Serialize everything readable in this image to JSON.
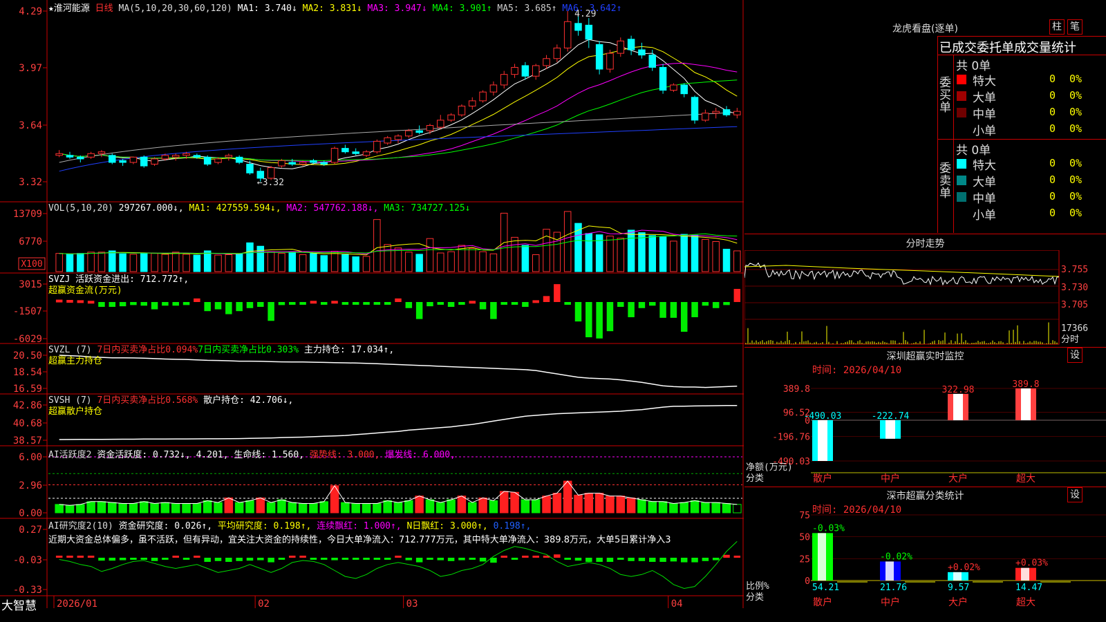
{
  "kline": {
    "stock_name": "★淮河能源",
    "period": "日线",
    "ma_header": "MA(5,10,20,30,60,120)",
    "ma_values": [
      {
        "label": "MA1: 3.740↓",
        "color": "#ffffff"
      },
      {
        "label": "MA2: 3.831↓",
        "color": "#ffff00"
      },
      {
        "label": "MA3: 3.947↓",
        "color": "#ff00ff"
      },
      {
        "label": "MA4: 3.901↑",
        "color": "#00ff00"
      },
      {
        "label": "MA5: 3.685↑",
        "color": "#cccccc"
      },
      {
        "label": "MA6: 3.642↑",
        "color": "#2040ff"
      }
    ],
    "y_ticks": [
      "4.29",
      "3.97",
      "3.64",
      "3.32"
    ],
    "high_label": "4.29",
    "low_label": "←3.32",
    "candles": [
      [
        3.47,
        3.5,
        3.46,
        3.48
      ],
      [
        3.47,
        3.49,
        3.45,
        3.46
      ],
      [
        3.46,
        3.47,
        3.43,
        3.45
      ],
      [
        3.46,
        3.49,
        3.45,
        3.48
      ],
      [
        3.48,
        3.5,
        3.46,
        3.49
      ],
      [
        3.47,
        3.48,
        3.42,
        3.43
      ],
      [
        3.44,
        3.45,
        3.41,
        3.43
      ],
      [
        3.43,
        3.46,
        3.42,
        3.46
      ],
      [
        3.46,
        3.47,
        3.4,
        3.41
      ],
      [
        3.42,
        3.46,
        3.41,
        3.45
      ],
      [
        3.45,
        3.48,
        3.44,
        3.47
      ],
      [
        3.46,
        3.48,
        3.44,
        3.47
      ],
      [
        3.47,
        3.49,
        3.45,
        3.48
      ],
      [
        3.47,
        3.48,
        3.45,
        3.46
      ],
      [
        3.46,
        3.47,
        3.41,
        3.42
      ],
      [
        3.43,
        3.46,
        3.42,
        3.45
      ],
      [
        3.46,
        3.48,
        3.44,
        3.47
      ],
      [
        3.46,
        3.47,
        3.42,
        3.43
      ],
      [
        3.42,
        3.44,
        3.36,
        3.37
      ],
      [
        3.38,
        3.4,
        3.32,
        3.34
      ],
      [
        3.34,
        3.41,
        3.33,
        3.4
      ],
      [
        3.41,
        3.45,
        3.4,
        3.44
      ],
      [
        3.43,
        3.45,
        3.41,
        3.42
      ],
      [
        3.42,
        3.44,
        3.41,
        3.43
      ],
      [
        3.44,
        3.45,
        3.42,
        3.43
      ],
      [
        3.43,
        3.44,
        3.41,
        3.42
      ],
      [
        3.43,
        3.52,
        3.42,
        3.51
      ],
      [
        3.51,
        3.53,
        3.48,
        3.49
      ],
      [
        3.49,
        3.51,
        3.47,
        3.48
      ],
      [
        3.47,
        3.5,
        3.46,
        3.49
      ],
      [
        3.49,
        3.56,
        3.48,
        3.55
      ],
      [
        3.54,
        3.58,
        3.53,
        3.57
      ],
      [
        3.56,
        3.59,
        3.54,
        3.58
      ],
      [
        3.58,
        3.62,
        3.57,
        3.61
      ],
      [
        3.61,
        3.64,
        3.59,
        3.6
      ],
      [
        3.61,
        3.65,
        3.59,
        3.64
      ],
      [
        3.63,
        3.7,
        3.62,
        3.67
      ],
      [
        3.67,
        3.71,
        3.66,
        3.7
      ],
      [
        3.7,
        3.76,
        3.69,
        3.75
      ],
      [
        3.75,
        3.8,
        3.73,
        3.78
      ],
      [
        3.78,
        3.84,
        3.77,
        3.83
      ],
      [
        3.83,
        3.89,
        3.81,
        3.87
      ],
      [
        3.87,
        3.95,
        3.85,
        3.93
      ],
      [
        3.93,
        3.99,
        3.91,
        3.97
      ],
      [
        3.98,
        4.0,
        3.9,
        3.92
      ],
      [
        3.92,
        3.99,
        3.9,
        3.98
      ],
      [
        3.98,
        4.04,
        3.96,
        4.02
      ],
      [
        4.02,
        4.1,
        4.0,
        4.08
      ],
      [
        4.08,
        4.29,
        4.06,
        4.23
      ],
      [
        4.22,
        4.28,
        4.15,
        4.18
      ],
      [
        4.21,
        4.25,
        4.08,
        4.13
      ],
      [
        4.1,
        4.12,
        3.93,
        3.96
      ],
      [
        3.96,
        4.07,
        3.94,
        4.05
      ],
      [
        4.05,
        4.14,
        4.03,
        4.12
      ],
      [
        4.13,
        4.15,
        4.04,
        4.07
      ],
      [
        4.07,
        4.11,
        4.02,
        4.04
      ],
      [
        4.04,
        4.07,
        3.95,
        3.97
      ],
      [
        3.97,
        3.99,
        3.82,
        3.84
      ],
      [
        3.84,
        3.88,
        3.83,
        3.87
      ],
      [
        3.87,
        3.88,
        3.8,
        3.82
      ],
      [
        3.8,
        3.81,
        3.65,
        3.67
      ],
      [
        3.67,
        3.73,
        3.66,
        3.71
      ],
      [
        3.71,
        3.74,
        3.68,
        3.72
      ],
      [
        3.73,
        3.75,
        3.69,
        3.7
      ],
      [
        3.7,
        3.74,
        3.68,
        3.72
      ]
    ],
    "x_labels": [
      {
        "label": "2026/01",
        "idx": 0
      },
      {
        "label": "02",
        "idx": 19
      },
      {
        "label": "03",
        "idx": 33
      },
      {
        "label": "04",
        "idx": 58
      }
    ]
  },
  "vol": {
    "title": "VOL(5,10,20)",
    "value": "297267.000↓,",
    "ma_values": [
      {
        "label": "MA1: 427559.594↓,",
        "color": "#ffff00"
      },
      {
        "label": "MA2: 547762.188↓,",
        "color": "#ff00ff"
      },
      {
        "label": "MA3: 734727.125↓",
        "color": "#00ff00"
      }
    ],
    "y_ticks": [
      "13709",
      "6770"
    ],
    "unit": "X100",
    "values": [
      430,
      410,
      430,
      460,
      460,
      490,
      420,
      410,
      440,
      430,
      410,
      460,
      410,
      390,
      490,
      390,
      400,
      420,
      680,
      600,
      470,
      430,
      460,
      400,
      430,
      380,
      480,
      400,
      350,
      360,
      1230,
      640,
      560,
      460,
      410,
      780,
      440,
      470,
      620,
      550,
      470,
      420,
      1380,
      810,
      620,
      400,
      1000,
      930,
      1420,
      1140,
      900,
      870,
      840,
      790,
      980,
      920,
      850,
      820,
      720,
      880,
      860,
      760,
      710,
      530,
      490,
      310
    ],
    "ymax": 13709
  },
  "svzj": {
    "title": "SVZJ  活跃资金进出: 712.772↑,",
    "subtitle": "超赢资金流(万元)",
    "y_ticks": [
      "3015",
      "-1507",
      "-6029"
    ],
    "values": [
      400,
      350,
      300,
      200,
      -800,
      -800,
      -700,
      -500,
      -600,
      -1200,
      -600,
      -600,
      -500,
      600,
      -1500,
      -1200,
      -2000,
      -1500,
      -1000,
      -800,
      -3100,
      -500,
      -200,
      -300,
      200,
      -300,
      200,
      -300,
      -200,
      -200,
      -300,
      -200,
      600,
      -1000,
      -2800,
      -700,
      -300,
      -800,
      -300,
      200,
      -1200,
      -2800,
      -400,
      -300,
      -800,
      300,
      1000,
      3000,
      -300,
      -3200,
      -5800,
      -6000,
      -4800,
      -800,
      -2500,
      -1000,
      -600,
      -2600,
      -2600,
      -4900,
      -2500,
      -600,
      -1000,
      -500,
      2200,
      1300,
      300,
      500
    ],
    "ymin": -6029,
    "ymax": 3015
  },
  "svzl": {
    "title": "SVZL (7)",
    "red_text": "7日内买卖净占比0.094%",
    "green_text": "7日内买卖净占比0.303%",
    "value": "主力持仓: 17.034↑,",
    "subtitle": "超赢主力持仓",
    "y_ticks": [
      "20.50",
      "18.54",
      "16.59"
    ],
    "values": [
      20.5,
      20.45,
      20.4,
      20.3,
      20.25,
      20.2,
      20.2,
      20.18,
      20.15,
      20.1,
      20.05,
      20.02,
      20.0,
      19.95,
      19.9,
      19.88,
      19.85,
      19.8,
      19.8,
      19.78,
      19.75,
      19.72,
      19.7,
      19.7,
      19.68,
      19.65,
      19.62,
      19.6,
      19.58,
      19.55,
      19.5,
      19.45,
      19.4,
      19.35,
      19.3,
      19.25,
      19.2,
      19.15,
      19.1,
      19.05,
      19.0,
      18.95,
      18.9,
      18.85,
      18.8,
      18.7,
      18.5,
      18.3,
      18.1,
      17.9,
      17.8,
      17.75,
      17.7,
      17.6,
      17.45,
      17.3,
      17.1,
      16.9,
      16.8,
      16.75,
      16.75,
      16.7,
      16.75,
      16.8,
      16.85,
      16.9,
      16.95,
      17.0
    ],
    "ymin": 16.59,
    "ymax": 20.5
  },
  "svsh": {
    "title": "SVSH (7)",
    "red_text": "7日内买卖净占比0.568%",
    "value": "散户持仓: 42.706↓,",
    "subtitle": "超赢散户持仓",
    "y_ticks": [
      "42.86",
      "40.68",
      "38.57"
    ],
    "values": [
      38.65,
      38.66,
      38.67,
      38.68,
      38.68,
      38.69,
      38.7,
      38.7,
      38.71,
      38.72,
      38.72,
      38.73,
      38.73,
      38.74,
      38.75,
      38.75,
      38.76,
      38.77,
      38.8,
      38.82,
      38.85,
      38.9,
      38.92,
      38.95,
      39.0,
      39.05,
      39.1,
      39.15,
      39.25,
      39.35,
      39.45,
      39.55,
      39.65,
      39.8,
      39.9,
      40.0,
      40.1,
      40.2,
      40.35,
      40.5,
      40.7,
      40.9,
      41.1,
      41.3,
      41.5,
      41.6,
      41.7,
      41.8,
      41.85,
      41.9,
      41.95,
      42.0,
      42.05,
      42.1,
      42.2,
      42.3,
      42.45,
      42.6,
      42.7,
      42.72,
      42.74,
      42.76,
      42.78,
      42.8,
      42.8,
      42.78,
      42.75,
      42.72
    ],
    "ymin": 38.57,
    "ymax": 42.86
  },
  "ai_active": {
    "title": "AI活跃度2",
    "value": "资金活跃度: 0.732↓,",
    "value2": "4.201,",
    "life_label": "生命线: 1.560,",
    "strong_label": "强势线: 3.000,",
    "burst_label": "爆发线: 6.000,",
    "y_ticks": [
      "6.00",
      "2.96",
      "0.00"
    ],
    "values": [
      0.9,
      0.8,
      0.9,
      1.2,
      1.2,
      1.1,
      1.0,
      1.0,
      1.2,
      1.0,
      1.1,
      1.0,
      1.0,
      1.0,
      1.3,
      1.1,
      1.6,
      1.1,
      1.3,
      1.6,
      1.1,
      1.4,
      1.1,
      1.0,
      1.0,
      1.2,
      2.9,
      1.1,
      1.0,
      1.0,
      1.0,
      1.3,
      1.1,
      1.3,
      1.8,
      1.4,
      1.1,
      1.4,
      1.8,
      1.1,
      1.6,
      1.3,
      2.3,
      2.2,
      1.4,
      1.4,
      1.8,
      2.1,
      3.4,
      1.9,
      2.1,
      2.1,
      1.8,
      1.8,
      1.6,
      1.4,
      1.2,
      1.2,
      1.0,
      1.1,
      1.3,
      1.1,
      1.1,
      1.0,
      0.9,
      0.8
    ],
    "ymax": 6.0
  },
  "ai_research": {
    "title": "AI研究度2(10)",
    "value": "资金研究度: 0.026↑,",
    "avg": "平均研究度: 0.198↑,",
    "red_count": "连续飘红: 1.000↑,",
    "n_red": "N日飘红: 3.000↑,",
    "last": "0.198↑,",
    "comment": "近期大资金总体偏多，虽不活跃，但有异动，宜关注大资金的持续性，今日大单净流入：712.777万元，其中特大单净流入：389.8万元，大单5日累计净入3",
    "y_ticks": [
      "0.27",
      "-0.03",
      "-0.33"
    ],
    "bars": [
      0.05,
      0.05,
      0.04,
      0.04,
      -0.07,
      -0.07,
      -0.06,
      -0.05,
      -0.05,
      -0.08,
      -0.05,
      0.04,
      -0.05,
      0.05,
      -0.1,
      -0.08,
      -0.1,
      -0.08,
      -0.07,
      -0.06,
      -0.11,
      -0.05,
      0.03,
      0.03,
      -0.04,
      -0.05,
      -0.06,
      -0.05,
      -0.04,
      -0.05,
      -0.04,
      -0.04,
      0.05,
      -0.06,
      -0.11,
      -0.05,
      -0.06,
      -0.08,
      -0.06,
      -0.04,
      -0.09,
      -0.12,
      0.04,
      -0.03,
      0.04,
      0.04,
      0.05,
      0.08,
      -0.02,
      -0.07,
      -0.1,
      -0.1,
      -0.1,
      -0.04,
      -0.08,
      -0.08,
      -0.1,
      -0.1,
      -0.09,
      -0.11,
      -0.11,
      -0.08,
      -0.06,
      0.07,
      0.05,
      0.03
    ],
    "line": [
      -0.03,
      -0.05,
      -0.08,
      -0.1,
      -0.15,
      -0.12,
      -0.08,
      -0.05,
      -0.04,
      -0.07,
      -0.1,
      -0.12,
      -0.1,
      -0.08,
      -0.12,
      -0.16,
      -0.14,
      -0.12,
      -0.08,
      -0.12,
      -0.16,
      -0.12,
      -0.06,
      -0.04,
      -0.05,
      -0.08,
      -0.14,
      -0.2,
      -0.22,
      -0.18,
      -0.12,
      -0.08,
      -0.06,
      -0.08,
      -0.1,
      -0.14,
      -0.2,
      -0.18,
      -0.14,
      -0.12,
      -0.08,
      0.0,
      0.06,
      0.1,
      0.08,
      0.05,
      0.02,
      -0.05,
      -0.1,
      -0.08,
      -0.06,
      -0.08,
      -0.12,
      -0.18,
      -0.2,
      -0.18,
      -0.14,
      -0.2,
      -0.28,
      -0.32,
      -0.3,
      -0.2,
      -0.08,
      0.05,
      0.15,
      0.24
    ],
    "ymin": -0.33,
    "ymax": 0.27
  },
  "brand": "大智慧",
  "right": {
    "longhu_title": "龙虎看盘(逐单)",
    "btn_bar": "柱",
    "btn_pen": "笔",
    "table_header": "已成交委托单成交量统计",
    "buy_label": "委买单",
    "sell_label": "委卖单",
    "buy_total": "共 0单",
    "sell_total": "共 0单",
    "buy_rows": [
      {
        "label": "特大",
        "count": "0",
        "pct": "0%",
        "color": "#ff0000"
      },
      {
        "label": "大单",
        "count": "0",
        "pct": "0%",
        "color": "#a00000"
      },
      {
        "label": "中单",
        "count": "0",
        "pct": "0%",
        "color": "#700000"
      },
      {
        "label": "小单",
        "count": "0",
        "pct": "0%",
        "color": "#000000"
      }
    ],
    "sell_rows": [
      {
        "label": "特大",
        "count": "0",
        "pct": "0%",
        "color": "#00ffff"
      },
      {
        "label": "大单",
        "count": "0",
        "pct": "0%",
        "color": "#008888"
      },
      {
        "label": "中单",
        "count": "0",
        "pct": "0%",
        "color": "#007070"
      },
      {
        "label": "小单",
        "count": "0",
        "pct": "0%",
        "color": "#000000"
      }
    ],
    "minute_title": "分时走势",
    "minute_prices": [
      "3.755",
      "3.730",
      "3.705"
    ],
    "minute_vol": "17366",
    "minute_unit": "分时",
    "realtime_title": "深圳超赢实时监控",
    "realtime_time": "时间: 2026/04/10",
    "realtime_settings": "设",
    "realtime_y": [
      "389.8",
      "96.52",
      "0",
      "-196.76",
      "-490.03"
    ],
    "realtime_axis_label": "净额(万元)",
    "realtime_cat_label": "分类",
    "realtime_bars": [
      {
        "cat": "散户",
        "value": -490.03,
        "label": "-490.03",
        "color": "#00ffff"
      },
      {
        "cat": "中户",
        "value": -222.74,
        "label": "-222.74",
        "color": "#00ffff"
      },
      {
        "cat": "大户",
        "value": 322.98,
        "label": "322.98",
        "color": "#ff4040"
      },
      {
        "cat": "超大",
        "value": 389.8,
        "label": "389.8",
        "color": "#ff4040"
      }
    ],
    "class_title": "深市超赢分类统计",
    "class_time": "时间: 2026/04/10",
    "class_settings": "设",
    "class_y": [
      "75",
      "50",
      "25",
      "0"
    ],
    "class_axis_label": "比例%",
    "class_cat_label": "分类",
    "class_bars": [
      {
        "cat": "散户",
        "value": 54.21,
        "change": "-0.03%",
        "color": "#00ff00",
        "label": "54.21"
      },
      {
        "cat": "中户",
        "value": 21.76,
        "change": "-0.02%",
        "color": "#0000ff",
        "label": "21.76"
      },
      {
        "cat": "大户",
        "value": 9.57,
        "change": "+0.02%",
        "color": "#00ffff",
        "label": "9.57"
      },
      {
        "cat": "超大",
        "value": 14.47,
        "change": "+0.03%",
        "color": "#ff2020",
        "label": "14.47"
      }
    ]
  }
}
